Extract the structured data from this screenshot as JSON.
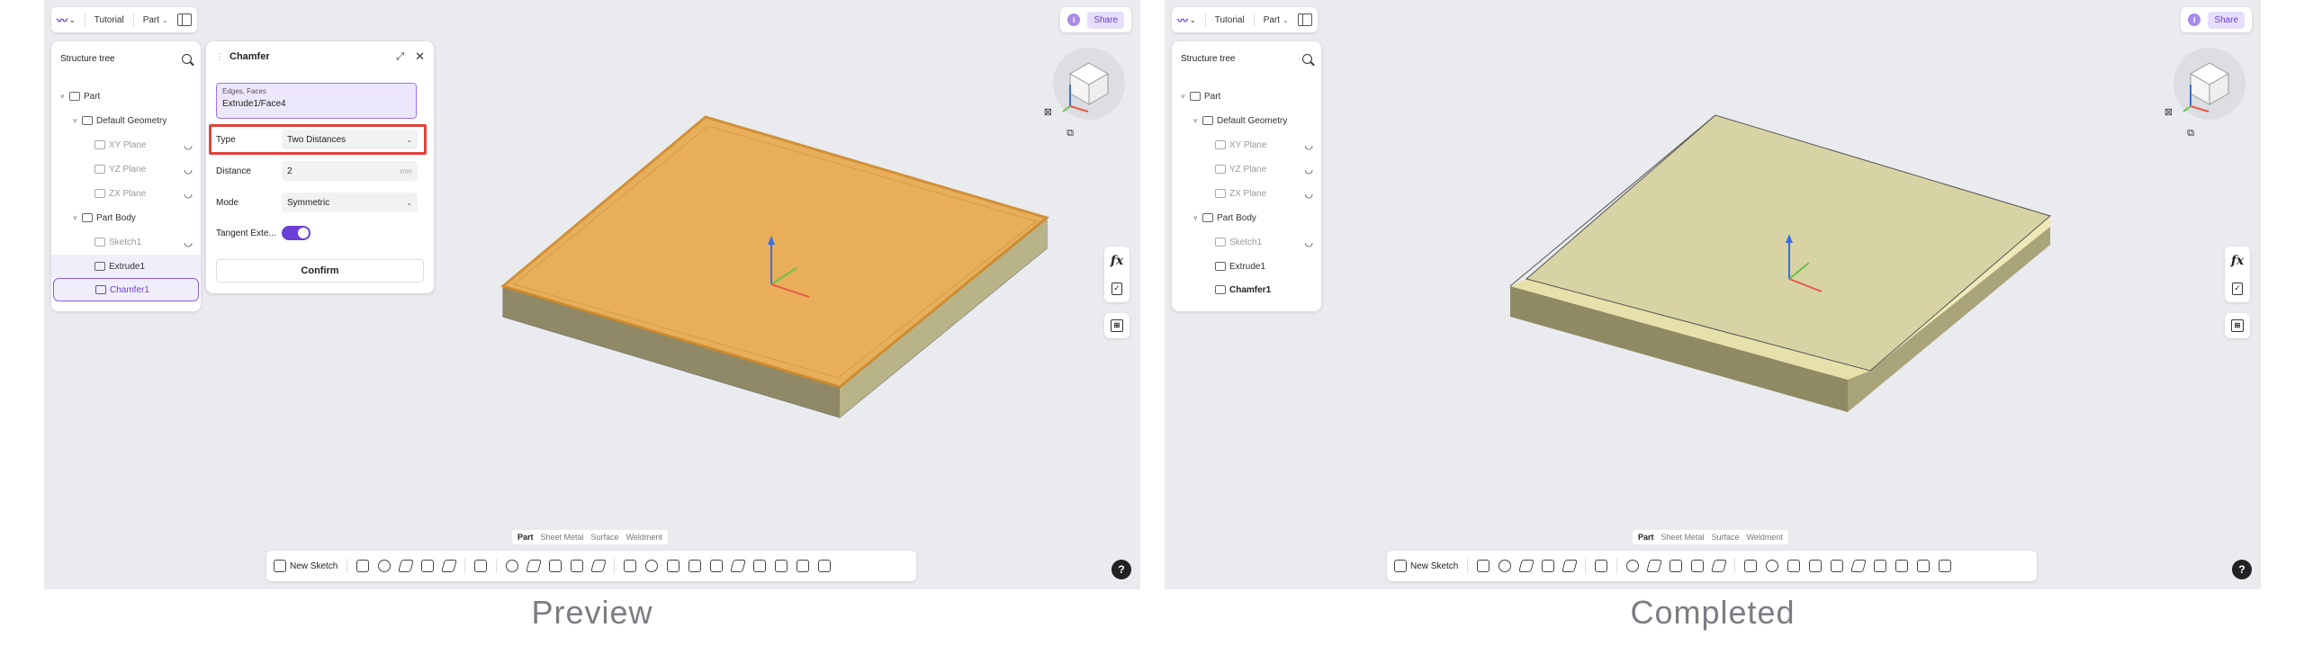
{
  "captions": {
    "left": "Preview",
    "right": "Completed"
  },
  "topbar": {
    "tutorial": "Tutorial",
    "part": "Part",
    "share": "Share",
    "info": "i"
  },
  "tree": {
    "title": "Structure tree",
    "items": [
      {
        "label": "Part"
      },
      {
        "label": "Default Geometry"
      },
      {
        "label": "XY Plane"
      },
      {
        "label": "YZ Plane"
      },
      {
        "label": "ZX Plane"
      },
      {
        "label": "Part Body"
      },
      {
        "label": "Sketch1"
      },
      {
        "label": "Extrude1"
      },
      {
        "label": "Chamfer1"
      }
    ]
  },
  "chamfer": {
    "title": "Chamfer",
    "edges_label": "Edges, Faces",
    "edges_value": "Extrude1/Face4",
    "type_label": "Type",
    "type_value": "Two Distances",
    "distance_label": "Distance",
    "distance_value": "2",
    "distance_unit": "mm",
    "mode_label": "Mode",
    "mode_value": "Symmetric",
    "tangent_label": "Tangent Exte...",
    "tangent_on": true,
    "confirm": "Confirm"
  },
  "bottom_tabs": [
    "Part",
    "Sheet Metal",
    "Surface",
    "Weldment"
  ],
  "toolbar": {
    "new_sketch": "New Sketch"
  },
  "rail": {
    "fx": "fx"
  },
  "help": "?",
  "colors": {
    "accent": "#6a3fd6",
    "highlight": "#e0443b",
    "preview_fill": "#e6a64a",
    "completed_fill": "#d8d3a4"
  }
}
